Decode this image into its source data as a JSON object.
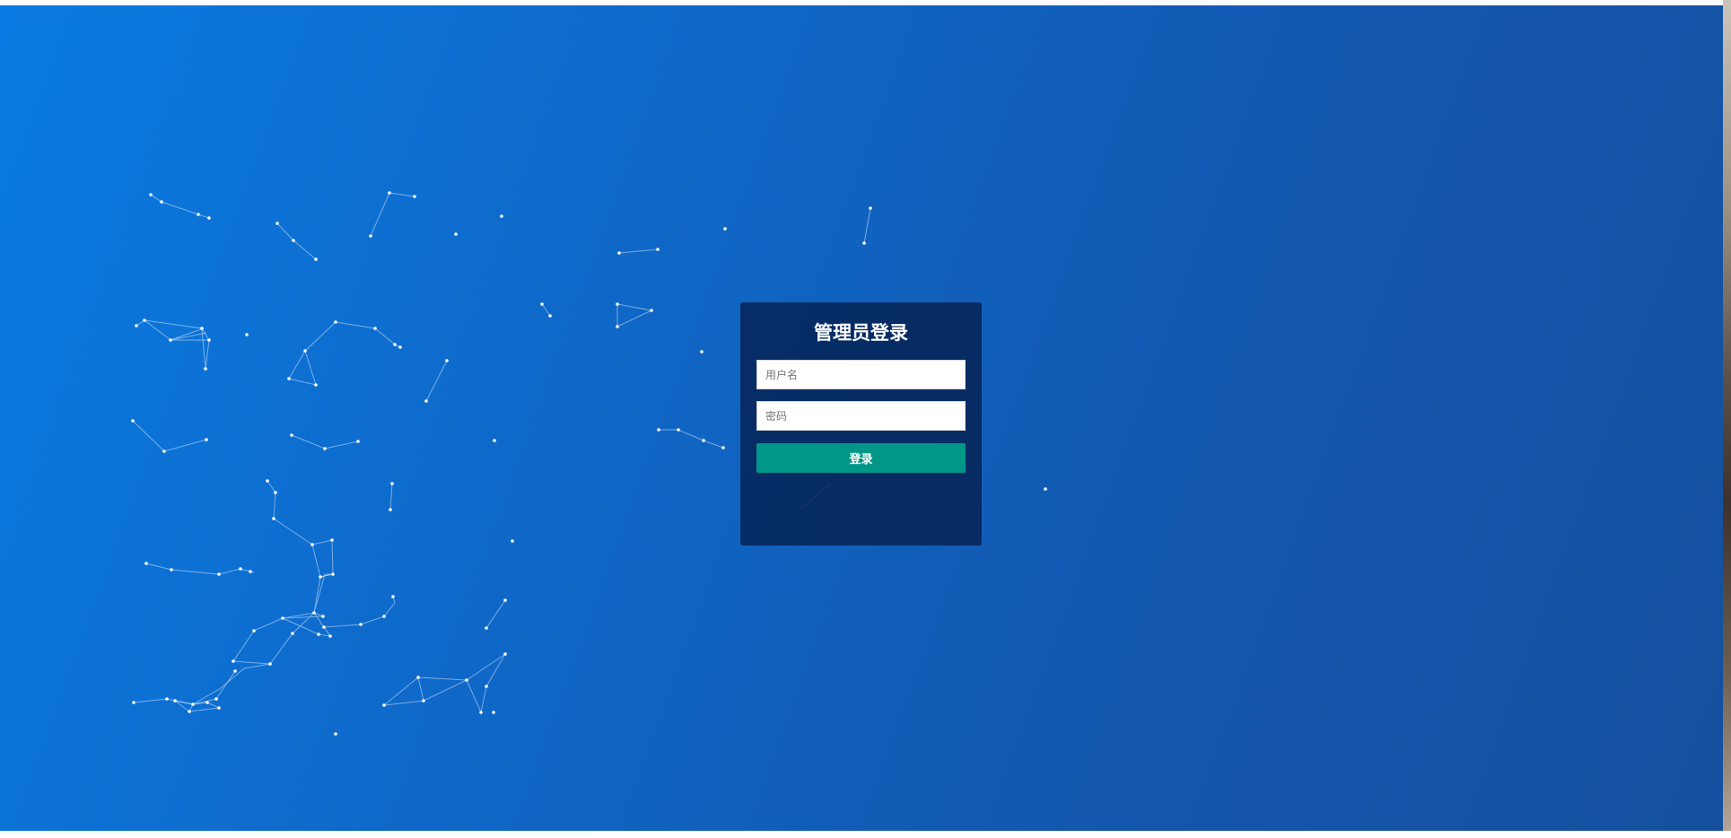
{
  "colors": {
    "background_start": "#0a7be2",
    "background_end": "#15509f",
    "panel": "#052150",
    "button": "#009688",
    "particle": "#ffffff"
  },
  "login": {
    "title": "管理员登录",
    "username_placeholder": "用户名",
    "password_placeholder": "密码",
    "submit_label": "登录"
  }
}
